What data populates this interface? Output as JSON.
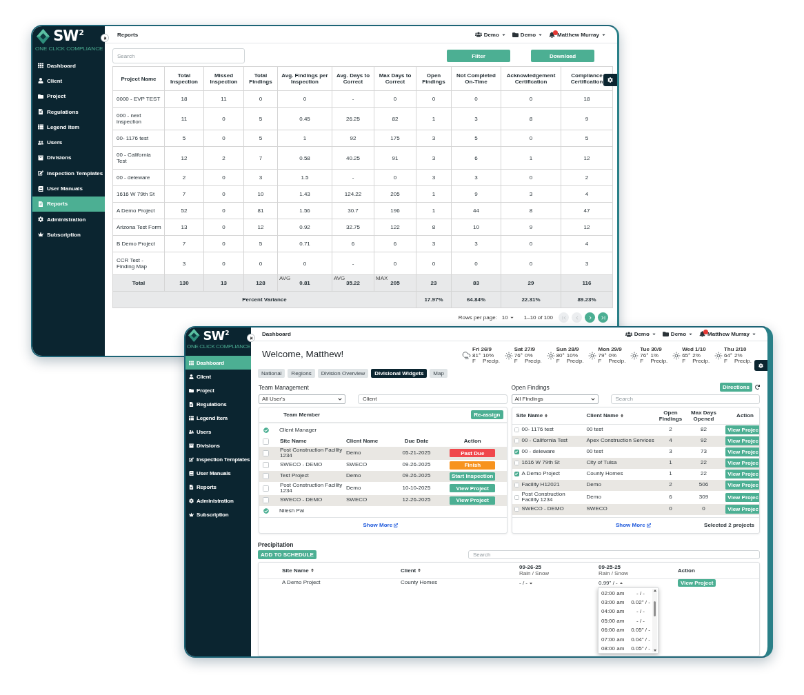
{
  "reports_window": {
    "logo": {
      "mark": "SW$^{2}$",
      "tagline": "ONE CLICK COMPLIANCE"
    },
    "sidebar": {
      "items": [
        {
          "label": "Dashboard",
          "selected": false
        },
        {
          "label": "Client",
          "selected": false
        },
        {
          "label": "Project",
          "selected": false
        },
        {
          "label": "Regulations",
          "selected": false
        },
        {
          "label": "Legend Item",
          "selected": false
        },
        {
          "label": "Users",
          "selected": false
        },
        {
          "label": "Divisions",
          "selected": false
        },
        {
          "label": "Inspection Templates",
          "selected": false
        },
        {
          "label": "User Manuals",
          "selected": false
        },
        {
          "label": "Reports",
          "selected": true
        },
        {
          "label": "Administration",
          "selected": false
        },
        {
          "label": "Subscription",
          "selected": false
        }
      ]
    },
    "header": {
      "title": "Reports",
      "menus": [
        {
          "label": "Demo"
        },
        {
          "label": "Demo"
        },
        {
          "label": "Matthew Murray"
        }
      ]
    },
    "search": {
      "placeholder": "Search"
    },
    "buttons": [
      "Filter",
      "Download"
    ],
    "table": {
      "columns": [
        "Project Name",
        "Total Inspection",
        "Missed Inspection",
        "Total Findings",
        "Avg. Findings per Inspection",
        "Avg. Days to Correct",
        "Max Days to Correct",
        "Open Findings",
        "Not Completed On-Time",
        "Acknowledgement Certification",
        "Compliance Certification"
      ],
      "rows": [
        [
          "0000 - EVP TEST",
          "18",
          "11",
          "0",
          "0",
          "-",
          "0",
          "0",
          "0",
          "0",
          "18"
        ],
        [
          "000 - next inspection",
          "11",
          "0",
          "5",
          "0.45",
          "26.25",
          "82",
          "1",
          "3",
          "8",
          "9"
        ],
        [
          "00- 1176 test",
          "5",
          "0",
          "5",
          "1",
          "92",
          "175",
          "3",
          "5",
          "0",
          "5"
        ],
        [
          "00 - California Test",
          "12",
          "2",
          "7",
          "0.58",
          "40.25",
          "91",
          "3",
          "6",
          "1",
          "12"
        ],
        [
          "00 - deleware",
          "2",
          "0",
          "3",
          "1.5",
          "-",
          "0",
          "3",
          "3",
          "0",
          "2"
        ],
        [
          "1616 W 79th St",
          "7",
          "0",
          "10",
          "1.43",
          "124.22",
          "205",
          "1",
          "9",
          "3",
          "4"
        ],
        [
          "A Demo Project",
          "52",
          "0",
          "81",
          "1.56",
          "30.7",
          "196",
          "1",
          "44",
          "8",
          "47"
        ],
        [
          "Arizona Test Form",
          "13",
          "0",
          "12",
          "0.92",
          "32.75",
          "122",
          "8",
          "10",
          "9",
          "12"
        ],
        [
          "B Demo Project",
          "7",
          "0",
          "5",
          "0.71",
          "6",
          "6",
          "3",
          "3",
          "0",
          "4"
        ],
        [
          "CCR Test - Finding Map",
          "3",
          "0",
          "0",
          "0",
          "-",
          "0",
          "0",
          "0",
          "0",
          "3"
        ]
      ],
      "total": {
        "label": "Total",
        "cells": [
          {
            "value": "130"
          },
          {
            "value": "13"
          },
          {
            "value": "128"
          },
          {
            "tag": "AVG",
            "value": "0.81"
          },
          {
            "tag": "AVG",
            "value": "35.22"
          },
          {
            "tag": "MAX",
            "value": "205"
          },
          {
            "value": "23"
          },
          {
            "value": "83"
          },
          {
            "value": "29"
          },
          {
            "value": "116"
          }
        ]
      },
      "variance": {
        "label": "Percent Variance",
        "values": [
          "17.97%",
          "64.84%",
          "22.31%",
          "89.23%"
        ]
      }
    },
    "pagination": {
      "rows_per_page_label": "Rows per page:",
      "rows_per_page": "10",
      "range": "1–10 of 100",
      "buttons": [
        {
          "disabled": true
        },
        {
          "disabled": true
        },
        {
          "disabled": false
        },
        {
          "disabled": false
        }
      ]
    }
  },
  "dashboard_window": {
    "logo": {
      "mark": "SW$^{2}$",
      "tagline": "ONE CLICK COMPLIANCE"
    },
    "sidebar": {
      "items": [
        {
          "label": "Dashboard",
          "selected": true
        },
        {
          "label": "Client",
          "selected": false
        },
        {
          "label": "Project",
          "selected": false
        },
        {
          "label": "Regulations",
          "selected": false
        },
        {
          "label": "Legend Item",
          "selected": false
        },
        {
          "label": "Users",
          "selected": false
        },
        {
          "label": "Divisions",
          "selected": false
        },
        {
          "label": "Inspection Templates",
          "selected": false
        },
        {
          "label": "User Manuals",
          "selected": false
        },
        {
          "label": "Reports",
          "selected": false
        },
        {
          "label": "Administration",
          "selected": false
        },
        {
          "label": "Subscription",
          "selected": false
        }
      ]
    },
    "header": {
      "title": "Dashboard",
      "menus": [
        {
          "label": "Demo"
        },
        {
          "label": "Demo"
        },
        {
          "label": "Matthew Murray"
        }
      ]
    },
    "welcome": "Welcome, Matthew!",
    "weather": [
      {
        "kind": "cloudy",
        "day": "Fri 26/9",
        "temperature": "81°",
        "precipitation": "10%",
        "unit": "F",
        "precip_label": "Precip."
      },
      {
        "kind": "sunny",
        "day": "Sat 27/9",
        "temperature": "76°",
        "precipitation": "0%",
        "unit": "F",
        "precip_label": "Precip."
      },
      {
        "kind": "sunny",
        "day": "Sun 28/9",
        "temperature": "80°",
        "precipitation": "10%",
        "unit": "F",
        "precip_label": "Precip."
      },
      {
        "kind": "sunny",
        "day": "Mon 29/9",
        "temperature": "79°",
        "precipitation": "0%",
        "unit": "F",
        "precip_label": "Precip."
      },
      {
        "kind": "sunny",
        "day": "Tue 30/9",
        "temperature": "76°",
        "precipitation": "1%",
        "unit": "F",
        "precip_label": "Precip."
      },
      {
        "kind": "sunny",
        "day": "Wed 1/10",
        "temperature": "65°",
        "precipitation": "2%",
        "unit": "F",
        "precip_label": "Precip."
      },
      {
        "kind": "sunny",
        "day": "Thu 2/10",
        "temperature": "64°",
        "precipitation": "2%",
        "unit": "F",
        "precip_label": "Precip."
      }
    ],
    "tabs": [
      {
        "label": "National",
        "selected": false
      },
      {
        "label": "Regions",
        "selected": false
      },
      {
        "label": "Division Overview",
        "selected": false
      },
      {
        "label": "Divisional Widgets",
        "selected": true
      },
      {
        "label": "Map",
        "selected": false
      }
    ],
    "team_management": {
      "title": "Team Management",
      "user_filter": {
        "value": "All User's"
      },
      "client_field": {
        "value": "Client"
      },
      "header": "Team Member",
      "reassign_button": "Re-assign",
      "groups": [
        {
          "name": "Client Manager",
          "select_all": {
            "checked": false
          },
          "columns": [
            "Site Name",
            "Client Name",
            "Due Date",
            "Action"
          ],
          "rows": [
            {
              "checked": false,
              "site": "Post Construction Facility 1234",
              "client": "Demo",
              "due_date": "05-21-2025",
              "action": {
                "label": "Past Due",
                "color": "#f0474c"
              }
            },
            {
              "checked": false,
              "site": "SWECO - DEMO",
              "client": "SWECO",
              "due_date": "09-26-2025",
              "action": {
                "label": "Finish",
                "color": "#f7931e"
              }
            },
            {
              "checked": false,
              "site": "Test Project",
              "client": "Demo",
              "due_date": "09-26-2025",
              "action": {
                "label": "Start Inspection",
                "color": "#4caf93"
              }
            },
            {
              "checked": false,
              "site": "Post Construction Facility 1234",
              "client": "Demo",
              "due_date": "10-10-2025",
              "action": {
                "label": "View Project",
                "color": "#4caf93"
              }
            },
            {
              "checked": false,
              "site": "SWECO - DEMO",
              "client": "SWECO",
              "due_date": "12-26-2025",
              "action": {
                "label": "View Project",
                "color": "#4caf93"
              }
            }
          ]
        },
        {
          "name": "Nilesh Pai"
        }
      ],
      "show_more": "Show More"
    },
    "open_findings": {
      "title": "Open Findings",
      "directions_button": "Directions",
      "filter": {
        "value": "All Findings"
      },
      "search": {
        "placeholder": "Search"
      },
      "columns": [
        {
          "label": "Site Name",
          "sortable": true
        },
        {
          "label": "Client Name",
          "sortable": true
        },
        {
          "label": "Open Findings",
          "sortable": false
        },
        {
          "label": "Max Days Opened",
          "sortable": false
        },
        {
          "label": "Action",
          "sortable": false
        }
      ],
      "rows": [
        {
          "checked": false,
          "site": "00- 1176 test",
          "client": "00 test",
          "open_findings": "2",
          "max_days": "82",
          "action": "View Projec"
        },
        {
          "checked": false,
          "site": "00 - California Test",
          "client": "Apex Construction Services",
          "open_findings": "4",
          "max_days": "92",
          "action": "View Projec"
        },
        {
          "checked": true,
          "site": "00 - deleware",
          "client": "00 test",
          "open_findings": "3",
          "max_days": "73",
          "action": "View Projec"
        },
        {
          "checked": false,
          "site": "1616 W 79th St",
          "client": "City of Tulsa",
          "open_findings": "1",
          "max_days": "22",
          "action": "View Projec"
        },
        {
          "checked": true,
          "site": "A Demo Project",
          "client": "County Homes",
          "open_findings": "1",
          "max_days": "22",
          "action": "View Projec"
        },
        {
          "checked": false,
          "site": "Facility H12021",
          "client": "Demo",
          "open_findings": "2",
          "max_days": "506",
          "action": "View Projec"
        },
        {
          "checked": false,
          "site": "Post Construction Facility 1234",
          "client": "Demo",
          "open_findings": "6",
          "max_days": "309",
          "action": "View Projec"
        },
        {
          "checked": false,
          "site": "SWECO - DEMO",
          "client": "SWECO",
          "open_findings": "0",
          "max_days": "0",
          "action": "View Projec"
        }
      ],
      "show_more": "Show More",
      "selection_summary": "Selected 2 projects"
    },
    "precipitation": {
      "title": "Precipitation",
      "add_button": "ADD TO SCHEDULE",
      "search": {
        "placeholder": "Search"
      },
      "columns": [
        {
          "label": "Site Name",
          "sortable": true
        },
        {
          "label": "Client",
          "sortable": true
        },
        {
          "label": "09-26-25",
          "sublabel": "Rain / Snow",
          "sortable": false
        },
        {
          "label": "09-25-25",
          "sublabel": "Rain / Snow",
          "sortable": false
        },
        {
          "label": "Action",
          "sortable": false
        }
      ],
      "rows": [
        {
          "site": "A Demo Project",
          "client": "County Homes",
          "readings": [
            {
              "value": "- / -",
              "expanded": false
            },
            {
              "value": "0.99\" / -",
              "expanded": true,
              "options": [
                {
                  "time": "02:00 am",
                  "value": "- / -"
                },
                {
                  "time": "03:00 am",
                  "value": "0.02\" / -"
                },
                {
                  "time": "04:00 am",
                  "value": "- / -"
                },
                {
                  "time": "05:00 am",
                  "value": "- / -"
                },
                {
                  "time": "06:00 am",
                  "value": "0.05\" / -"
                },
                {
                  "time": "07:00 am",
                  "value": "0.04\" / -"
                },
                {
                  "time": "08:00 am",
                  "value": "0.05\" / -"
                }
              ]
            }
          ],
          "action": "View Project"
        }
      ]
    }
  }
}
